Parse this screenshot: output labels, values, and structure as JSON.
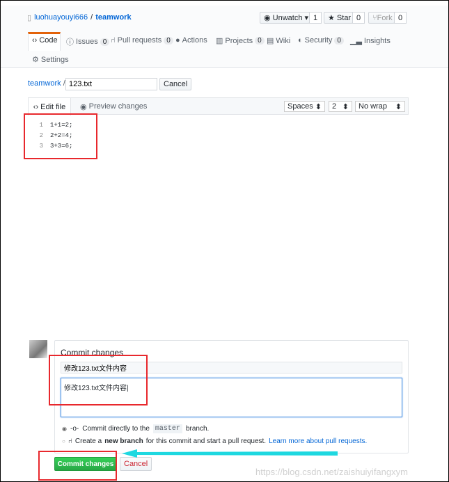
{
  "repo": {
    "owner": "luohuayouyi666",
    "separator": "/",
    "name": "teamwork"
  },
  "actions": {
    "watch": "Unwatch",
    "watch_count": "1",
    "star": "Star",
    "star_count": "0",
    "fork": "Fork",
    "fork_count": "0"
  },
  "tabs": [
    {
      "label": "Code",
      "icon": "code-icon"
    },
    {
      "label": "Issues",
      "count": "0",
      "icon": "issue-icon"
    },
    {
      "label": "Pull requests",
      "count": "0",
      "icon": "pull-request-icon"
    },
    {
      "label": "Actions",
      "icon": "play-icon"
    },
    {
      "label": "Projects",
      "count": "0",
      "icon": "project-icon"
    },
    {
      "label": "Wiki",
      "icon": "book-icon"
    },
    {
      "label": "Security",
      "count": "0",
      "icon": "shield-icon"
    },
    {
      "label": "Insights",
      "icon": "graph-icon"
    },
    {
      "label": "Settings",
      "icon": "gear-icon"
    }
  ],
  "breadcrumb": {
    "root": "teamwork",
    "separator": "/",
    "filename": "123.txt",
    "cancel": "Cancel"
  },
  "editor": {
    "tab_edit": "Edit file",
    "tab_preview": "Preview changes",
    "indent_mode": "Spaces",
    "indent_size": "2",
    "wrap_mode": "No wrap",
    "lines": [
      {
        "n": "1",
        "text": "1+1=2;"
      },
      {
        "n": "2",
        "text": "2+2=4;"
      },
      {
        "n": "3",
        "text": "3+3=6;"
      }
    ]
  },
  "commit": {
    "title": "Commit changes",
    "summary": "修改123.txt文件内容",
    "description": "修改123.txt文件内容",
    "option_direct_pre": "Commit directly to the",
    "branch": "master",
    "option_direct_post": "branch.",
    "option_new_pre": "Create a",
    "option_new_bold": "new branch",
    "option_new_post": "for this commit and start a pull request.",
    "learn_more": "Learn more about pull requests.",
    "submit": "Commit changes",
    "cancel": "Cancel"
  },
  "watermark": "https://blog.csdn.net/zaishuiyifangxym",
  "colors": {
    "accent": "#0366d6",
    "primary": "#28a745",
    "annotation": "#e8282d",
    "arrow": "#1ed8e0"
  }
}
